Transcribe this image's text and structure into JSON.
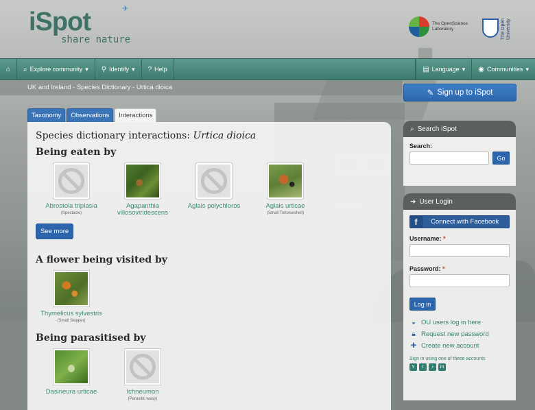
{
  "brand": {
    "logo_main": "iSpot",
    "logo_tagline": "share nature"
  },
  "partners": {
    "osl": "The OpenScience Laboratory",
    "ou": "The Open University"
  },
  "nav": {
    "explore": "Explore community",
    "identify": "Identify",
    "help": "Help",
    "language": "Language",
    "communities": "Communities"
  },
  "breadcrumb": "UK and Ireland - Species Dictionary - Urtica dioica",
  "signup": "Sign up to iSpot",
  "tabs": [
    "Taxonomy",
    "Observations",
    "Interactions"
  ],
  "main": {
    "title_prefix": "Species dictionary interactions: ",
    "title_species": "Urtica dioica",
    "sections": [
      {
        "heading": "Being eaten by",
        "items": [
          {
            "name": "Abrostola triplasia",
            "common": "(Spectacle)",
            "image": "none"
          },
          {
            "name": "Agapanthia villosoviridescens",
            "common": "",
            "image": "photo"
          },
          {
            "name": "Aglais polychloros",
            "common": "",
            "image": "none"
          },
          {
            "name": "Aglais urticae",
            "common": "(Small Tortoiseshell)",
            "image": "photo"
          }
        ],
        "see_more": "See more"
      },
      {
        "heading": "A flower being visited by",
        "items": [
          {
            "name": "Thymelicus sylvestris",
            "common": "(Small Skipper)",
            "image": "photo"
          }
        ]
      },
      {
        "heading": "Being parasitised by",
        "items": [
          {
            "name": "Dasineura urticae",
            "common": "",
            "image": "photo"
          },
          {
            "name": "Ichneumon",
            "common": "(Parasitic wasp)",
            "image": "none"
          }
        ]
      }
    ]
  },
  "search_box": {
    "title": "Search iSpot",
    "label": "Search:",
    "button": "Go"
  },
  "login_box": {
    "title": "User Login",
    "facebook": "Connect with Facebook",
    "username_label": "Username:",
    "password_label": "Password:",
    "required_mark": "*",
    "login_button": "Log in",
    "links": [
      "OU users log in here",
      "Request new password",
      "Create new account"
    ],
    "alt_signin": "Sign in using one of these accounts"
  }
}
